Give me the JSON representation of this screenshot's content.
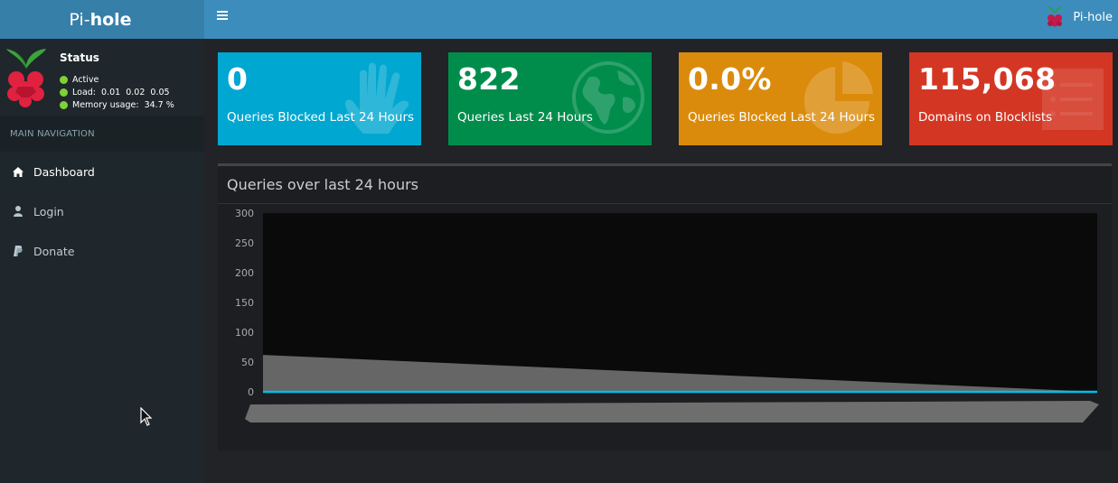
{
  "app": {
    "brand_light": "Pi-",
    "brand_bold": "hole",
    "top_username": "Pi-hole"
  },
  "sidebar": {
    "status_title": "Status",
    "status_lines": [
      "Active",
      "Load:  0.01  0.02  0.05",
      "Memory usage:  34.7 %"
    ],
    "nav_header": "MAIN NAVIGATION",
    "items": [
      {
        "label": "Dashboard",
        "icon": "home-icon",
        "active": true
      },
      {
        "label": "Login",
        "icon": "user-icon",
        "active": false
      },
      {
        "label": "Donate",
        "icon": "paypal-icon",
        "active": false
      }
    ]
  },
  "stats": [
    {
      "value": "0",
      "label": "Queries Blocked Last 24 Hours",
      "icon": "hand-icon",
      "color": "#00a7d0"
    },
    {
      "value": "822",
      "label": "Queries Last 24 Hours",
      "icon": "globe-icon",
      "color": "#008d4c"
    },
    {
      "value": "0.0%",
      "label": "Queries Blocked Last 24 Hours",
      "icon": "pie-chart-icon",
      "color": "#db8b0b"
    },
    {
      "value": "115,068",
      "label": "Domains on Blocklists",
      "icon": "list-icon",
      "color": "#d33724"
    }
  ],
  "chart_panel": {
    "title": "Queries over last 24 hours"
  },
  "chart_data": {
    "type": "area",
    "title": "Queries over last 24 hours",
    "xlabel": "",
    "ylabel": "",
    "ylim": [
      0,
      300
    ],
    "yticks": [
      300,
      250,
      200,
      150,
      100,
      50,
      0
    ],
    "grid": false,
    "series": [
      {
        "values": [
          62,
          0
        ],
        "color": "#777777"
      },
      {
        "values": [
          0,
          0
        ],
        "color": "#00bfe8"
      }
    ]
  }
}
